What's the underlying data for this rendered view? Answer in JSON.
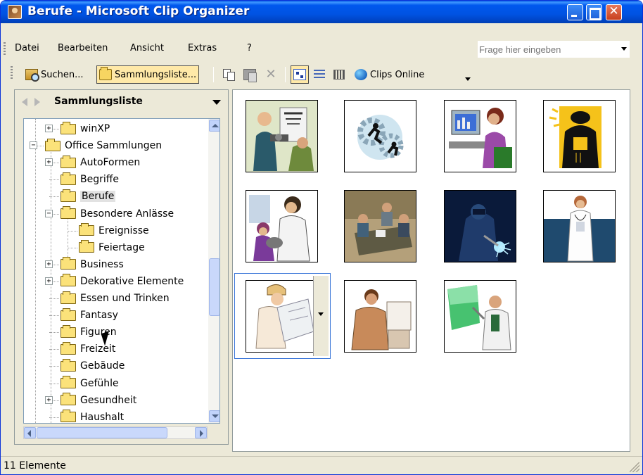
{
  "window": {
    "title": "Berufe - Microsoft Clip Organizer",
    "close_glyph": "✕"
  },
  "menubar": {
    "items": [
      "Datei",
      "Bearbeiten",
      "Ansicht",
      "Extras",
      "?"
    ],
    "ask_placeholder": "Frage hier eingeben"
  },
  "toolbar": {
    "search_label": "Suchen...",
    "collection_list_label": "Sammlungsliste...",
    "delete_glyph": "✕",
    "clips_online_label": "Clips Online"
  },
  "left_pane": {
    "title": "Sammlungsliste",
    "tree": [
      {
        "label": "winXP",
        "expander": "+",
        "level": 1
      },
      {
        "label": "Office Sammlungen",
        "expander": "−",
        "level": 0
      },
      {
        "label": "AutoFormen",
        "expander": "+",
        "level": 1
      },
      {
        "label": "Begriffe",
        "expander": "",
        "level": 1
      },
      {
        "label": "Berufe",
        "expander": "",
        "level": 1,
        "selected": true
      },
      {
        "label": "Besondere Anlässe",
        "expander": "−",
        "level": 1
      },
      {
        "label": "Ereignisse",
        "expander": "",
        "level": 2
      },
      {
        "label": "Feiertage",
        "expander": "",
        "level": 2
      },
      {
        "label": "Business",
        "expander": "+",
        "level": 1
      },
      {
        "label": "Dekorative Elemente",
        "expander": "+",
        "level": 1
      },
      {
        "label": "Essen und Trinken",
        "expander": "",
        "level": 1
      },
      {
        "label": "Fantasy",
        "expander": "",
        "level": 1
      },
      {
        "label": "Figuren",
        "expander": "",
        "level": 1
      },
      {
        "label": "Freizeit",
        "expander": "",
        "level": 1
      },
      {
        "label": "Gebäude",
        "expander": "",
        "level": 1
      },
      {
        "label": "Gefühle",
        "expander": "",
        "level": 1
      },
      {
        "label": "Gesundheit",
        "expander": "+",
        "level": 1
      },
      {
        "label": "Haushalt",
        "expander": "",
        "level": 1
      }
    ]
  },
  "clips": [
    {
      "name": "clip-optician"
    },
    {
      "name": "clip-gears-runners"
    },
    {
      "name": "clip-computer-worker"
    },
    {
      "name": "clip-construction-worker"
    },
    {
      "name": "clip-veterinarian"
    },
    {
      "name": "clip-meeting"
    },
    {
      "name": "clip-welder"
    },
    {
      "name": "clip-doctor"
    },
    {
      "name": "clip-architect"
    },
    {
      "name": "clip-office-worker"
    },
    {
      "name": "clip-presenter"
    }
  ],
  "status": {
    "text": "11 Elemente"
  },
  "colors": {
    "titlebar": "#0053e2",
    "selection": "#3874d8",
    "folder": "#fbe27a"
  }
}
